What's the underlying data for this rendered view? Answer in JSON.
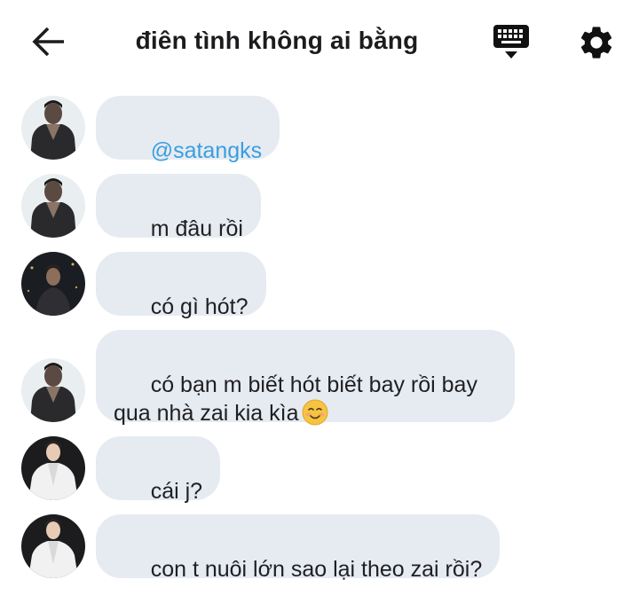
{
  "header": {
    "title": "điên tình không ai bằng",
    "back_icon": "arrow-left-icon",
    "keyboard_icon": "keyboard-icon",
    "settings_icon": "gear-icon"
  },
  "colors": {
    "bubble_bg": "#e6ebf1",
    "mention": "#3a9ee0",
    "text": "#1f1f22"
  },
  "messages": [
    {
      "text": "@satangks",
      "mention": true,
      "avatar": "avatar-shirtless-dark"
    },
    {
      "text": "m đâu rồi",
      "mention": false,
      "avatar": "avatar-shirtless-dark"
    },
    {
      "text": "có gì hót?",
      "mention": false,
      "avatar": "avatar-night-city"
    },
    {
      "text": "có bạn m biết hót biết bay rồi bay\nqua nhà zai kia kìa",
      "mention": false,
      "avatar": "avatar-shirtless-dark",
      "emoji": "smiling-face-emoji"
    },
    {
      "text": "cái j?",
      "mention": false,
      "avatar": "avatar-white-suit"
    },
    {
      "text": "con t nuôi lớn sao lại theo zai rồi?",
      "mention": false,
      "avatar": "avatar-white-suit"
    }
  ]
}
